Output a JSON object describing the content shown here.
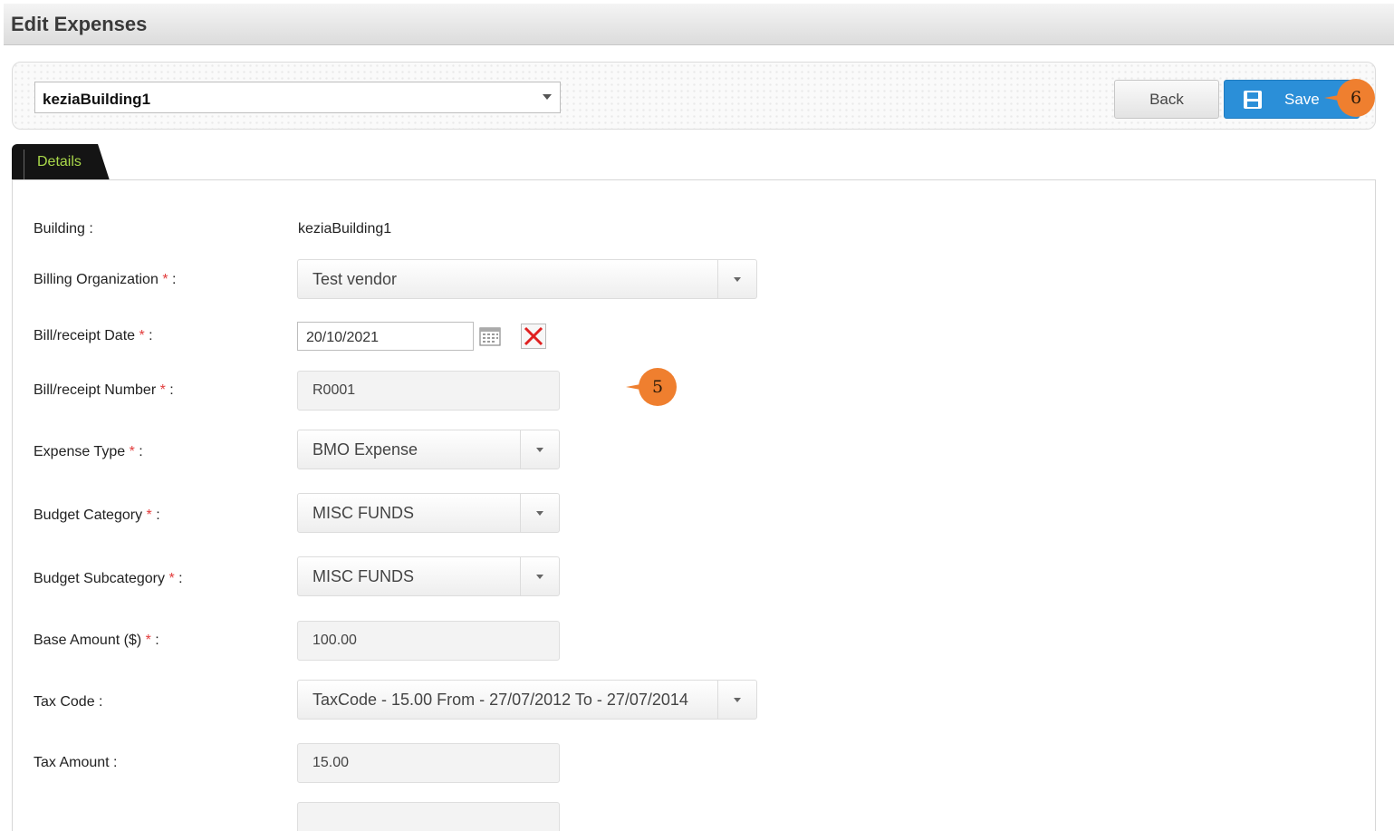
{
  "page": {
    "title": "Edit Expenses"
  },
  "toolbar": {
    "building_select": "keziaBuilding1",
    "back_label": "Back",
    "save_label": "Save"
  },
  "callouts": {
    "save": "6",
    "receipt_number": "5"
  },
  "tabs": [
    {
      "label": "Details",
      "active": true
    }
  ],
  "form": {
    "building": {
      "label": "Building :",
      "value": "keziaBuilding1"
    },
    "billing_org": {
      "label": "Billing Organization",
      "required": "*",
      "suffix": " :",
      "value": "Test vendor"
    },
    "bill_date": {
      "label": "Bill/receipt Date",
      "required": "*",
      "suffix": " :",
      "value": "20/10/2021"
    },
    "bill_number": {
      "label": "Bill/receipt Number",
      "required": "*",
      "suffix": " :",
      "value": "R0001"
    },
    "expense_type": {
      "label": "Expense Type",
      "required": "*",
      "suffix": " :",
      "value": "BMO Expense"
    },
    "budget_category": {
      "label": "Budget Category",
      "required": "*",
      "suffix": " :",
      "value": "MISC FUNDS"
    },
    "budget_subcategory": {
      "label": "Budget Subcategory",
      "required": "*",
      "suffix": " :",
      "value": "MISC FUNDS"
    },
    "base_amount": {
      "label": "Base Amount ($)",
      "required": "*",
      "suffix": " :",
      "value": "100.00"
    },
    "tax_code": {
      "label": "Tax Code :",
      "value": "TaxCode - 15.00 From - 27/07/2012 To - 27/07/2014"
    },
    "tax_amount": {
      "label": "Tax Amount :",
      "value": "15.00"
    }
  },
  "colors": {
    "save_button": "#2b8fd8",
    "callout": "#ef7f2f",
    "required": "#e23c3c",
    "tab_label": "#a9d84a"
  }
}
